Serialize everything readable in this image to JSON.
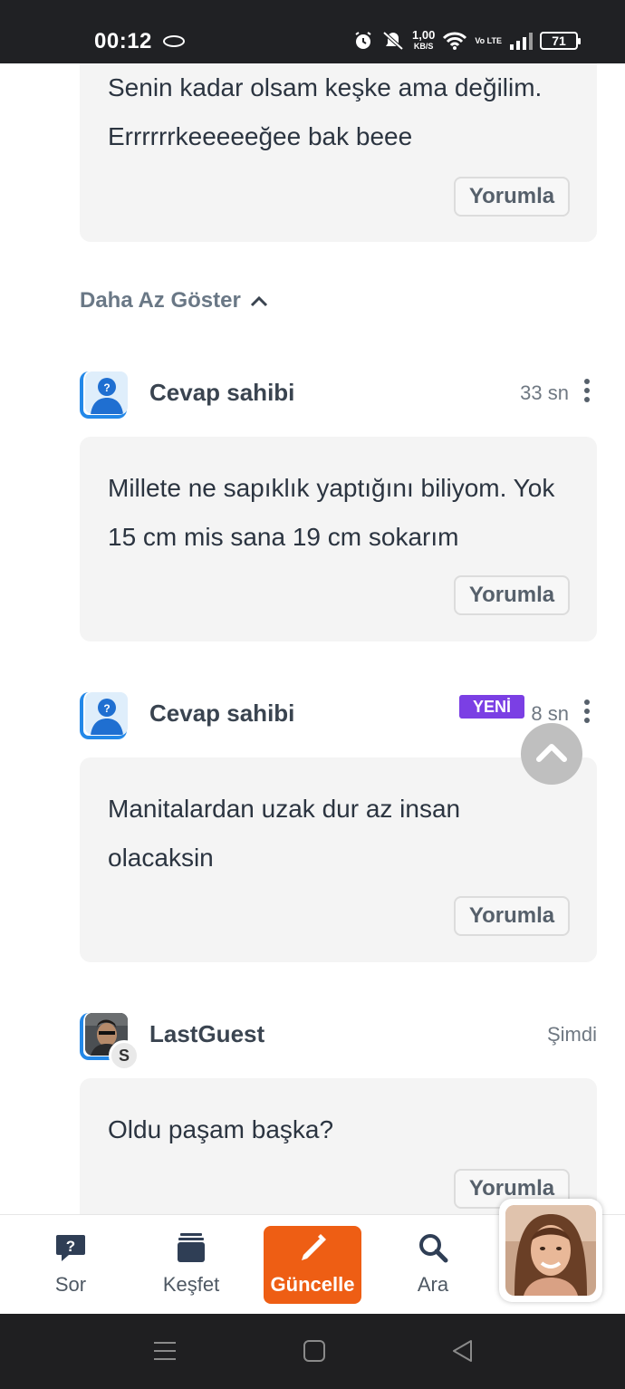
{
  "status_bar": {
    "time": "00:12",
    "net_speed_value": "1,00",
    "net_speed_unit": "KB/S",
    "volte": "Vo LTE",
    "battery": "71"
  },
  "comments": {
    "top_card": {
      "text": "Senin kadar olsam keşke ama değilim. Errrrrrkeeeeeğee bak beee",
      "reply_label": "Yorumla"
    },
    "show_less_label": "Daha Az Göster",
    "items": [
      {
        "author": "Cevap sahibi",
        "time": "33 sn",
        "text": "Millete ne sapıklık yaptığını biliyom. Yok 15 cm mis sana 19 cm sokarım",
        "reply_label": "Yorumla"
      },
      {
        "author": "Cevap sahibi",
        "badge": "YENİ",
        "time": "8 sn",
        "text": "Manitalardan uzak dur az insan olacaksin",
        "reply_label": "Yorumla"
      },
      {
        "author": "LastGuest",
        "sub_badge": "S",
        "time": "Şimdi",
        "text": "Oldu paşam başka?",
        "reply_label": "Yorumla"
      }
    ]
  },
  "bottom_nav": {
    "items": [
      {
        "label": "Sor",
        "icon": "question-bubble-icon"
      },
      {
        "label": "Keşfet",
        "icon": "stack-icon"
      },
      {
        "label": "Güncelle",
        "icon": "pencil-icon",
        "active": true
      },
      {
        "label": "Ara",
        "icon": "search-icon"
      }
    ],
    "accent_color": "#ee5e14"
  },
  "colors": {
    "new_badge": "#7b3fe4",
    "avatar_frame": "#2388e8"
  }
}
